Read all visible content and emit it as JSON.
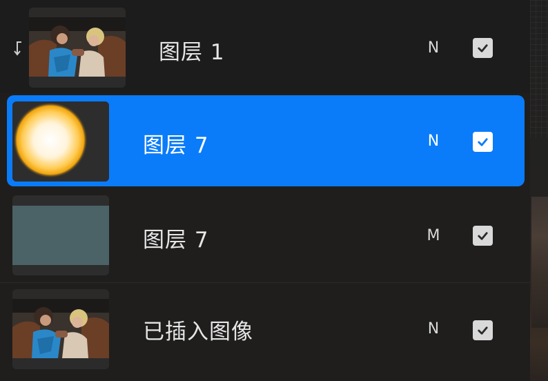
{
  "layers": [
    {
      "name": "图层 1",
      "blend_mode": "N",
      "visible": true,
      "clipping": true,
      "selected": false,
      "thumbnail_icon": "anime-illustration-thumbnail"
    },
    {
      "name": "图层 7",
      "blend_mode": "N",
      "visible": true,
      "clipping": false,
      "selected": true,
      "thumbnail_icon": "glow-orb-thumbnail"
    },
    {
      "name": "图层 7",
      "blend_mode": "M",
      "visible": true,
      "clipping": false,
      "selected": false,
      "thumbnail_icon": "slate-fill-thumbnail"
    },
    {
      "name": "已插入图像",
      "blend_mode": "N",
      "visible": true,
      "clipping": false,
      "selected": false,
      "thumbnail_icon": "anime-illustration-thumbnail"
    }
  ],
  "colors": {
    "panel_bg": "#1f1e1d",
    "selection_accent": "#0a7cf9",
    "slate_fill": "#4b6366",
    "glow_core": "#ffffff",
    "glow_edge": "#f2a50d"
  },
  "icons": {
    "clipping": "clipping-mask-arrow-icon",
    "visibility": "checkmark-icon"
  }
}
